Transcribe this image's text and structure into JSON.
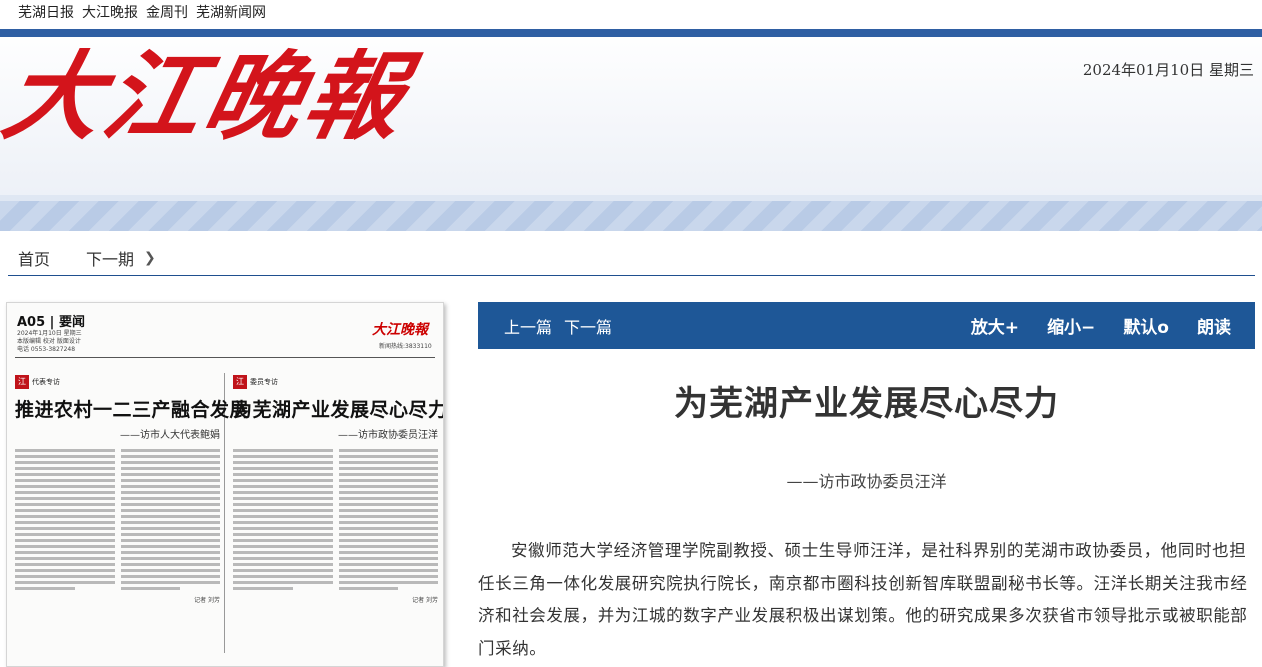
{
  "top_links": [
    "芜湖日报",
    "大江晚报",
    "金周刊",
    "芜湖新闻网"
  ],
  "banner": {
    "logo_text": "大江晚報",
    "date": "2024年01月10日  星期三"
  },
  "nav": {
    "home": "首页",
    "next_issue": "下一期"
  },
  "paper": {
    "page_label": "A05 | 要闻",
    "page_meta": "2024年1月10日 星期三",
    "page_meta2": "本版编辑 校对 版面设计",
    "page_meta3": "电话 0553-3827248",
    "logo": "大江晚報",
    "code": "新闻热线:3833110",
    "left": {
      "tag": "代表专访",
      "headline": "推进农村一二三产融合发展",
      "sub": "——访市人大代表鲍娟",
      "byline": "记者 刘芳"
    },
    "right": {
      "tag": "委员专访",
      "headline": "为芜湖产业发展尽心尽力",
      "sub": "——访市政协委员汪洋",
      "byline": "记者 刘芳"
    }
  },
  "toolbar": {
    "prev": "上一篇",
    "next": "下一篇",
    "zoom_in": "放大+",
    "zoom_out": "缩小−",
    "default": "默认o",
    "read": "朗读"
  },
  "article": {
    "title": "为芜湖产业发展尽心尽力",
    "subtitle": "——访市政协委员汪洋",
    "body": "安徽师范大学经济管理学院副教授、硕士生导师汪洋，是社科界别的芜湖市政协委员，他同时也担任长三角一体化发展研究院执行院长，南京都市圈科技创新智库联盟副秘书长等。汪洋长期关注我市经济和社会发展，并为江城的数字产业发展积极出谋划策。他的研究成果多次获省市领导批示或被职能部门采纳。"
  },
  "colors": {
    "accent": "#1e5797",
    "logo_red": "#d3141b"
  }
}
